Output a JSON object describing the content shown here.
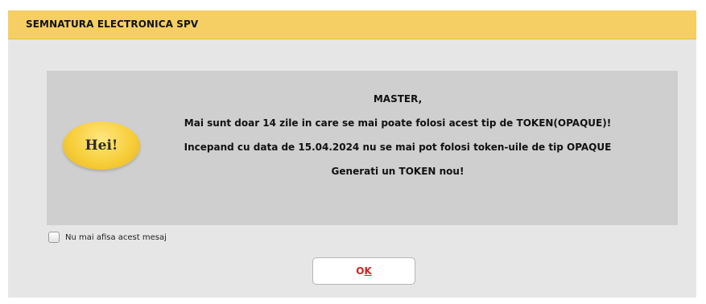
{
  "dialog": {
    "title": "SEMNATURA ELECTRONICA SPV",
    "badge_text": "Hei!",
    "message_lines": [
      "MASTER,",
      "Mai sunt doar 14 zile in care se mai poate folosi acest tip de TOKEN(OPAQUE)!",
      "Incepand cu data de 15.04.2024 nu se mai pot folosi token-uile de tip OPAQUE",
      "Generati un TOKEN nou!"
    ],
    "checkbox_label": "Nu mai afisa acest mesaj",
    "checkbox_checked": false,
    "ok_label_first": "O",
    "ok_label_mnemonic": "K"
  },
  "colors": {
    "titlebar": "#f5cf63",
    "window_bg": "#e6e6e6",
    "panel_bg": "#cfcfcf",
    "badge": "#f7cf3b",
    "ok_text": "#d42020"
  }
}
